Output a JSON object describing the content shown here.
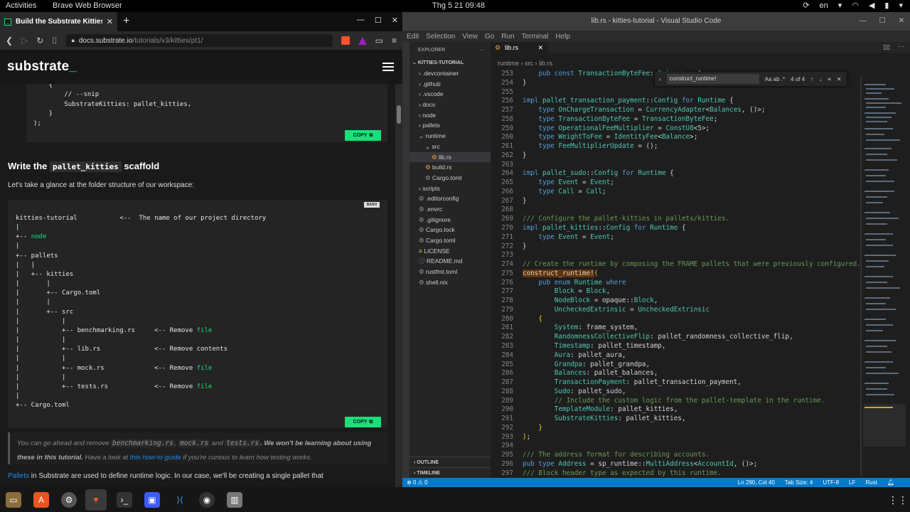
{
  "system": {
    "activities": "Activities",
    "app_name": "Brave Web Browser",
    "clock": "Thg 5 21  09:48",
    "lang": "en"
  },
  "browser": {
    "tab_title": "Build the Substrate Kitties",
    "url_host": "docs.substrate.io",
    "url_path": "/tutorials/v3/kitties/pt1/",
    "logo_text": "substrate",
    "logo_suffix": "_",
    "code1": "    {\n        // --snip\n        SubstrateKitties: pallet_kitties,\n    }\n);",
    "copy_label": "COPY",
    "heading_pre": "Write the ",
    "heading_code": "pallet_kitties",
    "heading_post": " scaffold",
    "intro": "Let's take a glance at the folder structure of our workspace:",
    "bash_label": "BASH",
    "note_pre": "You can go ahead and remove ",
    "note_code1": "benchmarking.rs",
    "note_code2": "mock.rs",
    "note_and": " and ",
    "note_code3": "tests.rs",
    "note_bold": ". We won't be learning about using these in this tutorial.",
    "note_mid": " Have a look at ",
    "note_link": "this how-to guide",
    "note_post": " if you're curious to learn how testing works.",
    "p2_link": "Pallets",
    "p2_text": " in Substrate are used to define runtime logic. In our case, we'll be creating a single pallet that"
  },
  "vscode": {
    "title": "lib.rs - kitties-tutorial - Visual Studio Code",
    "menu": [
      "Edit",
      "Selection",
      "View",
      "Go",
      "Run",
      "Terminal",
      "Help"
    ],
    "explorer_label": "EXPLORER",
    "project": "KITTIES-TUTORIAL",
    "files": [
      {
        "name": ".devcontainer",
        "indent": 1,
        "type": "folder"
      },
      {
        "name": ".github",
        "indent": 1,
        "type": "folder"
      },
      {
        "name": ".vscode",
        "indent": 1,
        "type": "folder"
      },
      {
        "name": "docs",
        "indent": 1,
        "type": "folder"
      },
      {
        "name": "node",
        "indent": 1,
        "type": "folder"
      },
      {
        "name": "pallets",
        "indent": 1,
        "type": "folder"
      },
      {
        "name": "runtime",
        "indent": 1,
        "type": "folder-open"
      },
      {
        "name": "src",
        "indent": 2,
        "type": "folder-open"
      },
      {
        "name": "lib.rs",
        "indent": 3,
        "type": "rs",
        "selected": true
      },
      {
        "name": "build.rs",
        "indent": 2,
        "type": "rs"
      },
      {
        "name": "Cargo.toml",
        "indent": 2,
        "type": "toml"
      },
      {
        "name": "scripts",
        "indent": 1,
        "type": "folder"
      },
      {
        "name": ".editorconfig",
        "indent": 1,
        "type": "cfg"
      },
      {
        "name": ".envrc",
        "indent": 1,
        "type": "cfg"
      },
      {
        "name": ".gitignore",
        "indent": 1,
        "type": "cfg"
      },
      {
        "name": "Cargo.lock",
        "indent": 1,
        "type": "toml"
      },
      {
        "name": "Cargo.toml",
        "indent": 1,
        "type": "toml"
      },
      {
        "name": "LICENSE",
        "indent": 1,
        "type": "lic"
      },
      {
        "name": "README.md",
        "indent": 1,
        "type": "md"
      },
      {
        "name": "rustfmt.toml",
        "indent": 1,
        "type": "toml"
      },
      {
        "name": "shell.nix",
        "indent": 1,
        "type": "cfg"
      }
    ],
    "outline": "OUTLINE",
    "timeline": "TIMELINE",
    "editor_tab": "lib.rs",
    "breadcrumb": "runtime  ›  src  ›  lib.rs",
    "find_text": "construct_runtime!",
    "find_flags": "Aa  ab  .*",
    "find_count": "4 of 4",
    "line_numbers": "253\n254\n255\n256\n257\n258\n259\n260\n261\n262\n263\n264\n265\n266\n267\n268\n269\n270\n271\n272\n273\n274\n275\n276\n277\n278\n279\n280\n281\n282\n283\n284\n285\n286\n287\n288\n289\n290\n291\n292\n293\n294\n295\n296\n297",
    "status_left": "⊗ 0 ⚠ 0",
    "status_items": [
      "Ln 290, Col 40",
      "Tab Size: 4",
      "UTF-8",
      "LF",
      "Rust"
    ]
  }
}
